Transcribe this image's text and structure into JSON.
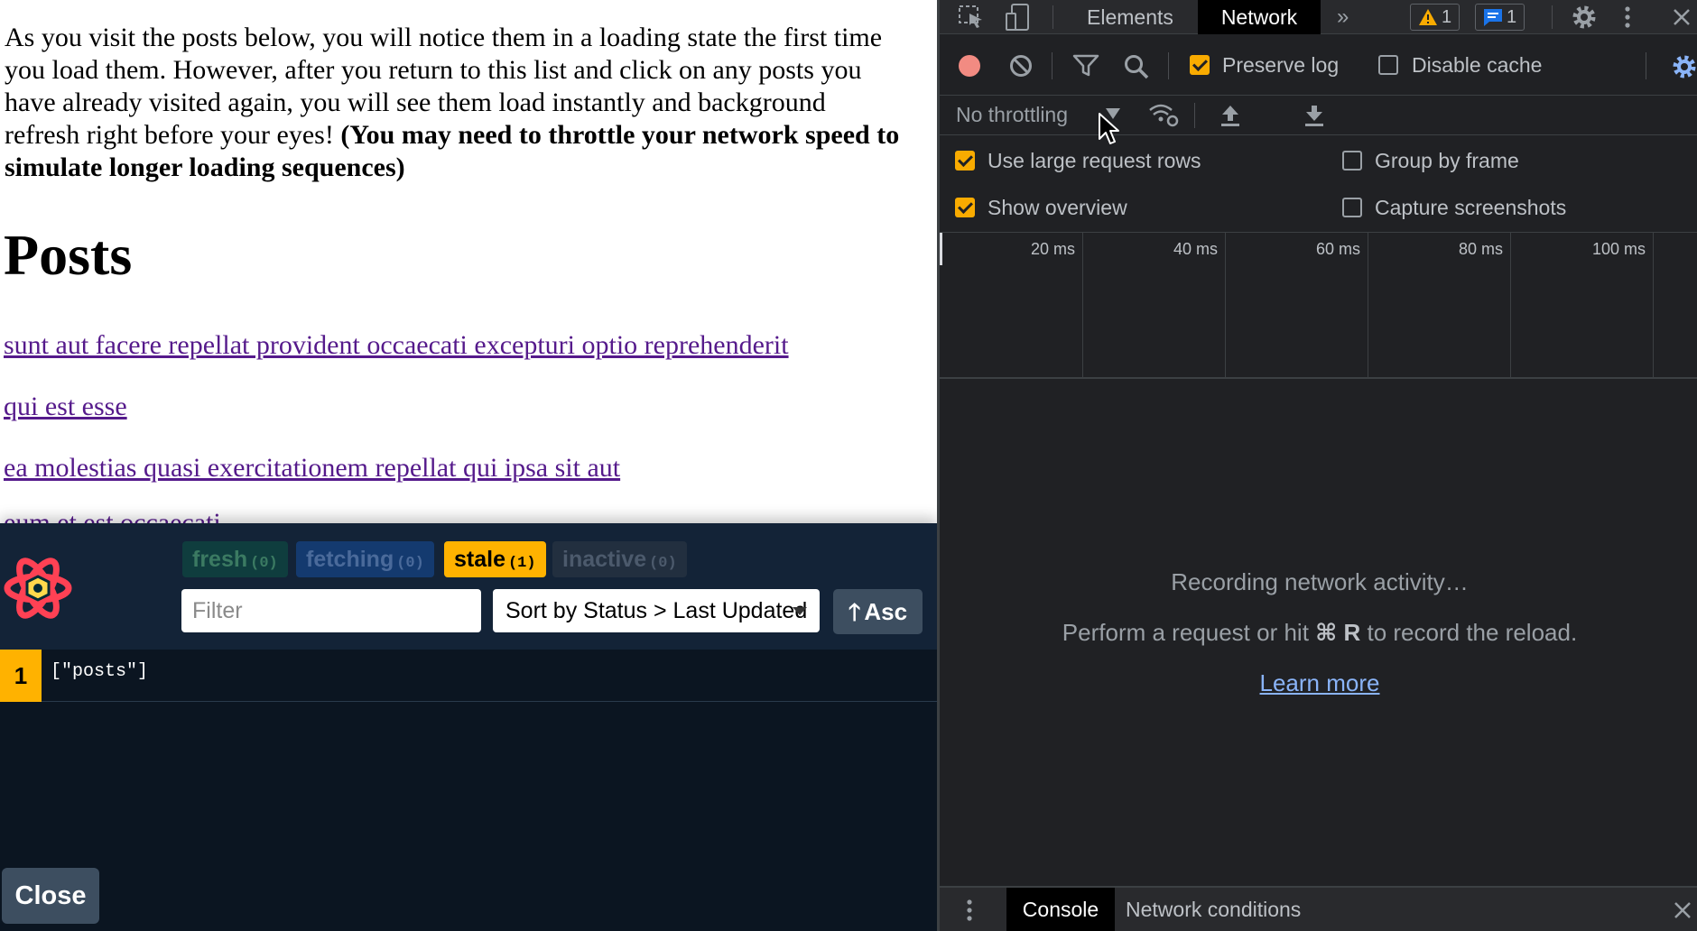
{
  "page": {
    "intro_text": "As you visit the posts below, you will notice them in a loading state the first time you load them. However, after you return to this list and click on any posts you have already visited again, you will see them load instantly and background refresh right before your eyes! ",
    "intro_bold": "(You may need to throttle your network speed to simulate longer loading sequences)",
    "heading": "Posts",
    "posts": [
      "sunt aut facere repellat provident occaecati excepturi optio reprehenderit",
      "qui est esse",
      "ea molestias quasi exercitationem repellat qui ipsa sit aut"
    ],
    "partial_post": "eum et est occaecati"
  },
  "query_devtools": {
    "badges": {
      "fresh": {
        "label": "fresh",
        "count": "(0)"
      },
      "fetching": {
        "label": "fetching",
        "count": "(0)"
      },
      "stale": {
        "label": "stale",
        "count": "(1)"
      },
      "inactive": {
        "label": "inactive",
        "count": "(0)"
      }
    },
    "filter_placeholder": "Filter",
    "sort_label": "Sort by Status > Last Updated",
    "order_label": "Asc",
    "queries": [
      {
        "observers": "1",
        "key": "[\"posts\"]"
      }
    ],
    "close_label": "Close",
    "colors": {
      "stale": "#ffb200",
      "panel": "#0b1521",
      "header": "#132337"
    }
  },
  "devtools": {
    "tabs": {
      "elements": "Elements",
      "network": "Network"
    },
    "warnings_count": "1",
    "messages_count": "1",
    "preserve_log": "Preserve log",
    "disable_cache": "Disable cache",
    "throttling": "No throttling",
    "settings": {
      "large_rows": "Use large request rows",
      "group_by_frame": "Group by frame",
      "show_overview": "Show overview",
      "capture_screenshots": "Capture screenshots"
    },
    "timeline_ticks": [
      "20 ms",
      "40 ms",
      "60 ms",
      "80 ms",
      "100 ms"
    ],
    "empty_title": "Recording network activity…",
    "empty_hint_pre": "Perform a request or hit ",
    "empty_hint_key": "⌘ R",
    "empty_hint_post": " to record the reload.",
    "learn_more": "Learn more",
    "drawer": {
      "console": "Console",
      "network_conditions": "Network conditions"
    },
    "colors": {
      "accent": "#f9ab00",
      "record": "#f28b82",
      "link": "#8ab4f8"
    }
  }
}
